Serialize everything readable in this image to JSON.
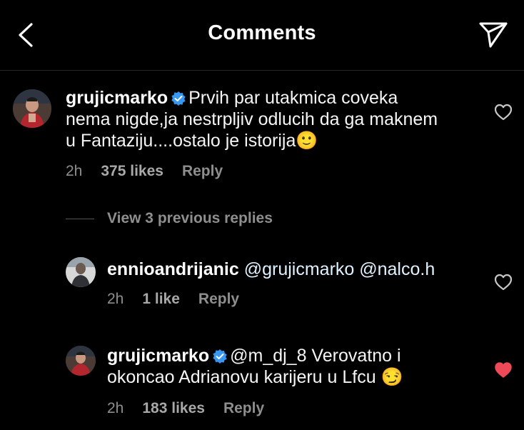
{
  "header": {
    "title": "Comments"
  },
  "comments": [
    {
      "username": "grujicmarko",
      "verified": true,
      "text_lines": [
        "Prvih par utakmica coveka",
        "nema nigde,ja nestrpljiv odlucih da ga maknem",
        "u Fantaziju....ostalo je istorija🙂"
      ],
      "time": "2h",
      "likes": "375 likes",
      "reply": "Reply",
      "liked": false
    }
  ],
  "view_replies": "View 3 previous replies",
  "replies": [
    {
      "username": "ennioandrijanic",
      "verified": false,
      "text": "@grujicmarko @nalco.h",
      "time": "2h",
      "likes": "1 like",
      "reply": "Reply",
      "liked": false
    },
    {
      "username": "grujicmarko",
      "verified": true,
      "text_line1": "@m_dj_8 Verovatno i",
      "text_line2": "okoncao Adrianovu karijeru u Lfcu 😏",
      "time": "2h",
      "likes": "183 likes",
      "reply": "Reply",
      "liked": true
    }
  ],
  "colors": {
    "liked_heart": "#ed4956",
    "verified": "#3897f0",
    "meta": "#8e8e8e"
  }
}
